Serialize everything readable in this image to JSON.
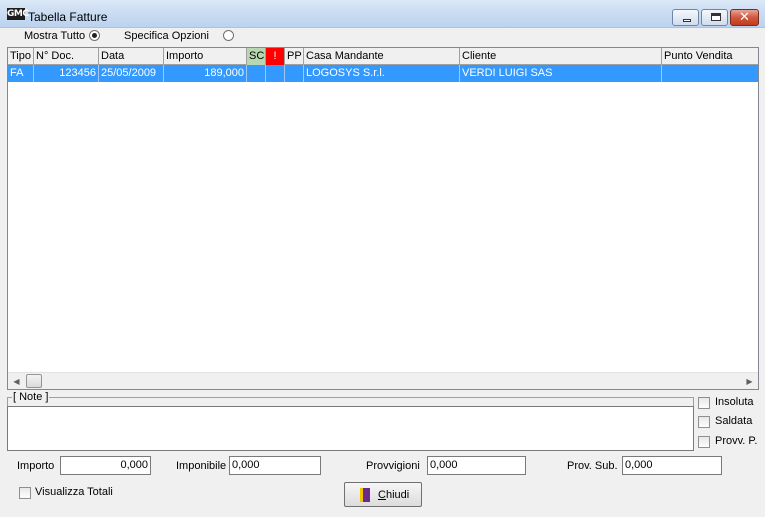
{
  "window": {
    "app_icon_text": "GMC",
    "title": "Tabella Fatture"
  },
  "options": {
    "mostra_tutto": {
      "label": "Mostra Tutto",
      "selected": true
    },
    "specifica_opzioni": {
      "label": "Specifica Opzioni",
      "selected": false
    }
  },
  "grid": {
    "columns": [
      "Tipo",
      "N° Doc.",
      "Data",
      "Importo",
      "SC",
      "!",
      "PP",
      "Casa Mandante",
      "Cliente",
      "Punto Vendita"
    ],
    "rows": [
      {
        "tipo": "FA",
        "n_doc": "123456",
        "data": "25/05/2009",
        "importo": "189,000",
        "sc": "",
        "flag": "",
        "pp": "",
        "casa_mandante": "LOGOSYS S.r.l.",
        "cliente": "VERDI LUIGI SAS",
        "punto_vendita": ""
      }
    ]
  },
  "note": {
    "legend": "[ Note ]",
    "value": ""
  },
  "checks": {
    "insoluta": "Insoluta",
    "saldata": "Saldata",
    "provv": "Provv. P.",
    "visualizza_totali": "Visualizza Totali"
  },
  "totals": {
    "importo_label": "Importo",
    "importo": "0,000",
    "imponibile_label": "Imponibile",
    "imponibile": "0,000",
    "provvigioni_label": "Provvigioni",
    "provvigioni": "0,000",
    "prov_sub_label": "Prov. Sub.",
    "prov_sub": "0,000"
  },
  "buttons": {
    "chiudi": "Chiudi"
  },
  "colors": {
    "selection": "#3399ff",
    "sc_header": "#b7d7b0",
    "flag_header": "#ff0000"
  }
}
